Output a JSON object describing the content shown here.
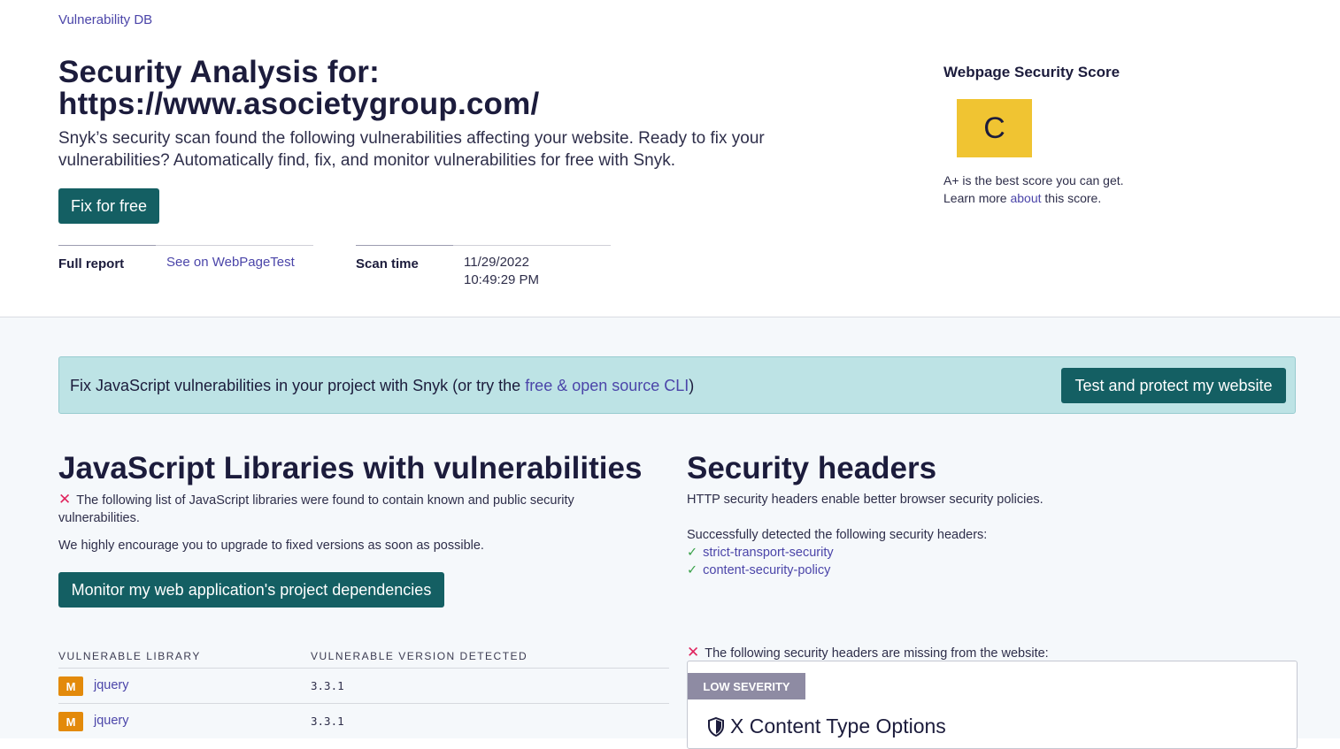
{
  "breadcrumb": "Vulnerability DB",
  "title_line1": "Security Analysis for:",
  "title_line2": "https://www.asocietygroup.com/",
  "intro_line1": "Snyk’s security scan found the following vulnerabilities affecting your website. Ready to fix your",
  "intro_line2": "vulnerabilities? Automatically find, fix, and monitor vulnerabilities for free with Snyk.",
  "fix_free_label": "Fix for free",
  "meta": {
    "full_report_label": "Full report",
    "full_report_link": "See on WebPageTest",
    "scan_time_label": "Scan time",
    "scan_date": "11/29/2022",
    "scan_clock": "10:49:29 PM"
  },
  "score": {
    "title": "Webpage Security Score",
    "grade": "C",
    "note_line1": "A+ is the best score you can get.",
    "note_pre": "Learn more ",
    "note_link": "about",
    "note_post": " this score."
  },
  "banner": {
    "text_pre": "Fix JavaScript vulnerabilities in your project with Snyk (or try the ",
    "text_link": "free & open source CLI",
    "text_post": ")",
    "button": "Test and protect my website"
  },
  "libraries": {
    "heading": "JavaScript Libraries with vulnerabilities",
    "warning_line1": "The following list of JavaScript libraries were found to contain known and public security",
    "warning_line2": "vulnerabilities.",
    "encourage": "We highly encourage you to upgrade to fixed versions as soon as possible.",
    "monitor_button": "Monitor my web application's project dependencies",
    "col_library": "VULNERABLE LIBRARY",
    "col_version": "VULNERABLE VERSION DETECTED",
    "rows": [
      {
        "severity": "M",
        "name": "jquery",
        "version": "3.3.1"
      },
      {
        "severity": "M",
        "name": "jquery",
        "version": "3.3.1"
      }
    ]
  },
  "headers": {
    "heading": "Security headers",
    "description": "HTTP security headers enable better browser security policies.",
    "detected_intro": "Successfully detected the following security headers:",
    "detected": [
      "strict-transport-security",
      "content-security-policy"
    ],
    "missing_intro": "The following security headers are missing from the website:",
    "card_severity": "LOW SEVERITY",
    "card_title": "X Content Type Options"
  },
  "colors": {
    "primary_button": "#145f63",
    "link": "#4b45a9",
    "grade_bg": "#f0c432",
    "banner_bg": "#bde3e5",
    "medium_badge": "#e38a0b",
    "low_severity": "#8e8ba3",
    "error": "#e0245e",
    "success": "#3aa24a"
  }
}
